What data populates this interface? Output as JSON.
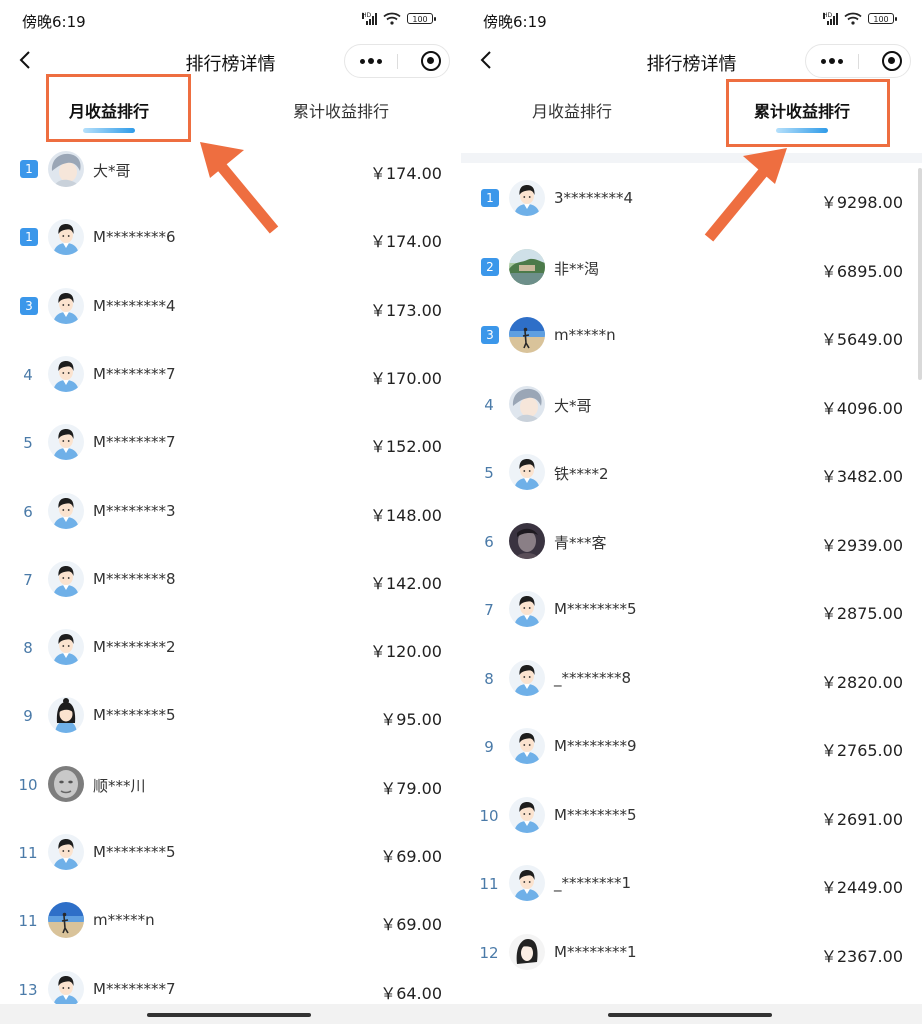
{
  "status_bar": {
    "time": "傍晚6:19",
    "battery": "100",
    "network": "HD"
  },
  "header": {
    "title": "排行榜详情"
  },
  "tabs": {
    "monthly": "月收益排行",
    "cumulative": "累计收益排行"
  },
  "colors": {
    "accent": "#3b97ea",
    "highlight": "#ee6e40",
    "rank_text": "#4a7aa8"
  },
  "monthly_ranking": [
    {
      "rank": "1",
      "badge": true,
      "name": "大*哥",
      "amount": "￥174.00",
      "avatar": "anime-boy-avatar"
    },
    {
      "rank": "1",
      "badge": true,
      "name": "M********6",
      "amount": "￥174.00",
      "avatar": "default-boy-avatar"
    },
    {
      "rank": "3",
      "badge": true,
      "name": "M********4",
      "amount": "￥173.00",
      "avatar": "default-boy-avatar"
    },
    {
      "rank": "4",
      "badge": false,
      "name": "M********7",
      "amount": "￥170.00",
      "avatar": "default-boy-avatar"
    },
    {
      "rank": "5",
      "badge": false,
      "name": "M********7",
      "amount": "￥152.00",
      "avatar": "default-boy-avatar"
    },
    {
      "rank": "6",
      "badge": false,
      "name": "M********3",
      "amount": "￥148.00",
      "avatar": "default-boy-avatar"
    },
    {
      "rank": "7",
      "badge": false,
      "name": "M********8",
      "amount": "￥142.00",
      "avatar": "default-boy-avatar"
    },
    {
      "rank": "8",
      "badge": false,
      "name": "M********2",
      "amount": "￥120.00",
      "avatar": "default-boy-avatar"
    },
    {
      "rank": "9",
      "badge": false,
      "name": "M********5",
      "amount": "￥95.00",
      "avatar": "default-girl-avatar"
    },
    {
      "rank": "10",
      "badge": false,
      "name": "顺***川",
      "amount": "￥79.00",
      "avatar": "photo-face-avatar"
    },
    {
      "rank": "11",
      "badge": false,
      "name": "M********5",
      "amount": "￥69.00",
      "avatar": "default-boy-avatar"
    },
    {
      "rank": "11",
      "badge": false,
      "name": "m*****n",
      "amount": "￥69.00",
      "avatar": "beach-photo-avatar"
    },
    {
      "rank": "13",
      "badge": false,
      "name": "M********7",
      "amount": "￥64.00",
      "avatar": "default-boy-avatar"
    }
  ],
  "cumulative_ranking": [
    {
      "rank": "1",
      "badge": true,
      "name": "3********4",
      "amount": "￥9298.00",
      "avatar": "default-boy-avatar"
    },
    {
      "rank": "2",
      "badge": true,
      "name": "非**渴",
      "amount": "￥6895.00",
      "avatar": "landscape-photo-avatar"
    },
    {
      "rank": "3",
      "badge": true,
      "name": "m*****n",
      "amount": "￥5649.00",
      "avatar": "beach-photo-avatar"
    },
    {
      "rank": "4",
      "badge": false,
      "name": "大*哥",
      "amount": "￥4096.00",
      "avatar": "anime-boy-avatar"
    },
    {
      "rank": "5",
      "badge": false,
      "name": "铁****2",
      "amount": "￥3482.00",
      "avatar": "default-boy-avatar"
    },
    {
      "rank": "6",
      "badge": false,
      "name": "青***客",
      "amount": "￥2939.00",
      "avatar": "dark-photo-avatar"
    },
    {
      "rank": "7",
      "badge": false,
      "name": "M********5",
      "amount": "￥2875.00",
      "avatar": "default-boy-avatar"
    },
    {
      "rank": "8",
      "badge": false,
      "name": "_********8",
      "amount": "￥2820.00",
      "avatar": "default-boy-avatar"
    },
    {
      "rank": "9",
      "badge": false,
      "name": "M********9",
      "amount": "￥2765.00",
      "avatar": "default-boy-avatar"
    },
    {
      "rank": "10",
      "badge": false,
      "name": "M********5",
      "amount": "￥2691.00",
      "avatar": "default-boy-avatar"
    },
    {
      "rank": "11",
      "badge": false,
      "name": "_********1",
      "amount": "￥2449.00",
      "avatar": "default-boy-avatar"
    },
    {
      "rank": "12",
      "badge": false,
      "name": "M********1",
      "amount": "￥2367.00",
      "avatar": "anime-girl-avatar"
    }
  ]
}
